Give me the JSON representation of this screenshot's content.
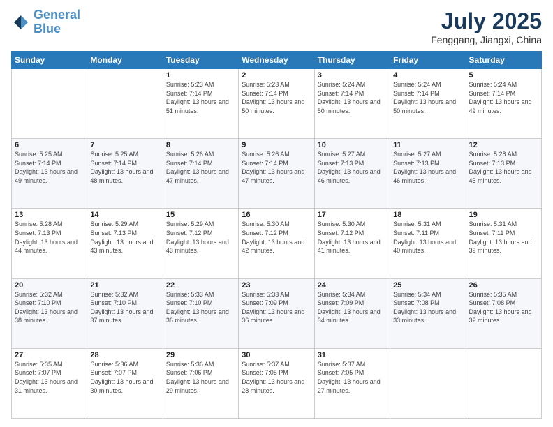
{
  "logo": {
    "line1": "General",
    "line2": "Blue"
  },
  "title": {
    "month_year": "July 2025",
    "location": "Fenggang, Jiangxi, China"
  },
  "weekdays": [
    "Sunday",
    "Monday",
    "Tuesday",
    "Wednesday",
    "Thursday",
    "Friday",
    "Saturday"
  ],
  "weeks": [
    [
      {
        "day": "",
        "sunrise": "",
        "sunset": "",
        "daylight": ""
      },
      {
        "day": "",
        "sunrise": "",
        "sunset": "",
        "daylight": ""
      },
      {
        "day": "1",
        "sunrise": "Sunrise: 5:23 AM",
        "sunset": "Sunset: 7:14 PM",
        "daylight": "Daylight: 13 hours and 51 minutes."
      },
      {
        "day": "2",
        "sunrise": "Sunrise: 5:23 AM",
        "sunset": "Sunset: 7:14 PM",
        "daylight": "Daylight: 13 hours and 50 minutes."
      },
      {
        "day": "3",
        "sunrise": "Sunrise: 5:24 AM",
        "sunset": "Sunset: 7:14 PM",
        "daylight": "Daylight: 13 hours and 50 minutes."
      },
      {
        "day": "4",
        "sunrise": "Sunrise: 5:24 AM",
        "sunset": "Sunset: 7:14 PM",
        "daylight": "Daylight: 13 hours and 50 minutes."
      },
      {
        "day": "5",
        "sunrise": "Sunrise: 5:24 AM",
        "sunset": "Sunset: 7:14 PM",
        "daylight": "Daylight: 13 hours and 49 minutes."
      }
    ],
    [
      {
        "day": "6",
        "sunrise": "Sunrise: 5:25 AM",
        "sunset": "Sunset: 7:14 PM",
        "daylight": "Daylight: 13 hours and 49 minutes."
      },
      {
        "day": "7",
        "sunrise": "Sunrise: 5:25 AM",
        "sunset": "Sunset: 7:14 PM",
        "daylight": "Daylight: 13 hours and 48 minutes."
      },
      {
        "day": "8",
        "sunrise": "Sunrise: 5:26 AM",
        "sunset": "Sunset: 7:14 PM",
        "daylight": "Daylight: 13 hours and 47 minutes."
      },
      {
        "day": "9",
        "sunrise": "Sunrise: 5:26 AM",
        "sunset": "Sunset: 7:14 PM",
        "daylight": "Daylight: 13 hours and 47 minutes."
      },
      {
        "day": "10",
        "sunrise": "Sunrise: 5:27 AM",
        "sunset": "Sunset: 7:13 PM",
        "daylight": "Daylight: 13 hours and 46 minutes."
      },
      {
        "day": "11",
        "sunrise": "Sunrise: 5:27 AM",
        "sunset": "Sunset: 7:13 PM",
        "daylight": "Daylight: 13 hours and 46 minutes."
      },
      {
        "day": "12",
        "sunrise": "Sunrise: 5:28 AM",
        "sunset": "Sunset: 7:13 PM",
        "daylight": "Daylight: 13 hours and 45 minutes."
      }
    ],
    [
      {
        "day": "13",
        "sunrise": "Sunrise: 5:28 AM",
        "sunset": "Sunset: 7:13 PM",
        "daylight": "Daylight: 13 hours and 44 minutes."
      },
      {
        "day": "14",
        "sunrise": "Sunrise: 5:29 AM",
        "sunset": "Sunset: 7:13 PM",
        "daylight": "Daylight: 13 hours and 43 minutes."
      },
      {
        "day": "15",
        "sunrise": "Sunrise: 5:29 AM",
        "sunset": "Sunset: 7:12 PM",
        "daylight": "Daylight: 13 hours and 43 minutes."
      },
      {
        "day": "16",
        "sunrise": "Sunrise: 5:30 AM",
        "sunset": "Sunset: 7:12 PM",
        "daylight": "Daylight: 13 hours and 42 minutes."
      },
      {
        "day": "17",
        "sunrise": "Sunrise: 5:30 AM",
        "sunset": "Sunset: 7:12 PM",
        "daylight": "Daylight: 13 hours and 41 minutes."
      },
      {
        "day": "18",
        "sunrise": "Sunrise: 5:31 AM",
        "sunset": "Sunset: 7:11 PM",
        "daylight": "Daylight: 13 hours and 40 minutes."
      },
      {
        "day": "19",
        "sunrise": "Sunrise: 5:31 AM",
        "sunset": "Sunset: 7:11 PM",
        "daylight": "Daylight: 13 hours and 39 minutes."
      }
    ],
    [
      {
        "day": "20",
        "sunrise": "Sunrise: 5:32 AM",
        "sunset": "Sunset: 7:10 PM",
        "daylight": "Daylight: 13 hours and 38 minutes."
      },
      {
        "day": "21",
        "sunrise": "Sunrise: 5:32 AM",
        "sunset": "Sunset: 7:10 PM",
        "daylight": "Daylight: 13 hours and 37 minutes."
      },
      {
        "day": "22",
        "sunrise": "Sunrise: 5:33 AM",
        "sunset": "Sunset: 7:10 PM",
        "daylight": "Daylight: 13 hours and 36 minutes."
      },
      {
        "day": "23",
        "sunrise": "Sunrise: 5:33 AM",
        "sunset": "Sunset: 7:09 PM",
        "daylight": "Daylight: 13 hours and 36 minutes."
      },
      {
        "day": "24",
        "sunrise": "Sunrise: 5:34 AM",
        "sunset": "Sunset: 7:09 PM",
        "daylight": "Daylight: 13 hours and 34 minutes."
      },
      {
        "day": "25",
        "sunrise": "Sunrise: 5:34 AM",
        "sunset": "Sunset: 7:08 PM",
        "daylight": "Daylight: 13 hours and 33 minutes."
      },
      {
        "day": "26",
        "sunrise": "Sunrise: 5:35 AM",
        "sunset": "Sunset: 7:08 PM",
        "daylight": "Daylight: 13 hours and 32 minutes."
      }
    ],
    [
      {
        "day": "27",
        "sunrise": "Sunrise: 5:35 AM",
        "sunset": "Sunset: 7:07 PM",
        "daylight": "Daylight: 13 hours and 31 minutes."
      },
      {
        "day": "28",
        "sunrise": "Sunrise: 5:36 AM",
        "sunset": "Sunset: 7:07 PM",
        "daylight": "Daylight: 13 hours and 30 minutes."
      },
      {
        "day": "29",
        "sunrise": "Sunrise: 5:36 AM",
        "sunset": "Sunset: 7:06 PM",
        "daylight": "Daylight: 13 hours and 29 minutes."
      },
      {
        "day": "30",
        "sunrise": "Sunrise: 5:37 AM",
        "sunset": "Sunset: 7:05 PM",
        "daylight": "Daylight: 13 hours and 28 minutes."
      },
      {
        "day": "31",
        "sunrise": "Sunrise: 5:37 AM",
        "sunset": "Sunset: 7:05 PM",
        "daylight": "Daylight: 13 hours and 27 minutes."
      },
      {
        "day": "",
        "sunrise": "",
        "sunset": "",
        "daylight": ""
      },
      {
        "day": "",
        "sunrise": "",
        "sunset": "",
        "daylight": ""
      }
    ]
  ]
}
